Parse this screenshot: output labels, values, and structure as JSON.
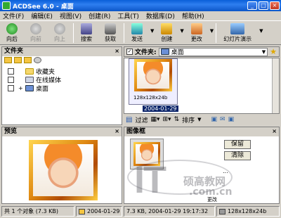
{
  "window": {
    "title": "ACDSee 6.0 - 桌面",
    "minimize": "_",
    "maximize": "□",
    "close": "×"
  },
  "menu": [
    "文件(F)",
    "编辑(E)",
    "视图(V)",
    "创建(R)",
    "工具(T)",
    "数据库(D)",
    "帮助(H)"
  ],
  "toolbar": {
    "back": "向后",
    "forward": "向前",
    "up": "向上",
    "search": "搜索",
    "acquire": "获取",
    "send": "发送",
    "create": "创建",
    "modify": "更改",
    "slideshow": "幻灯片演示"
  },
  "folders_panel": {
    "title": "文件夹",
    "items": [
      {
        "label": "收藏夹",
        "checked": false,
        "expander": ""
      },
      {
        "label": "在线媒体",
        "checked": false,
        "expander": ""
      },
      {
        "label": "桌面",
        "checked": false,
        "expander": "+"
      }
    ]
  },
  "address": {
    "label": "文件夹:",
    "value": "桌面",
    "checked": "✓"
  },
  "file_list": {
    "thumb_caption": "128x128x24b",
    "thumb_date": "2004-01-29"
  },
  "filter_bar": {
    "filter": "过滤",
    "sort": "排序"
  },
  "preview_panel": {
    "title": "预览"
  },
  "image_basket": {
    "title": "图像框",
    "keep": "保留",
    "clear": "清除",
    "more": "...",
    "manage": "更改"
  },
  "watermark": {
    "big": "IT",
    "site": ".com.cn",
    "cn": "硕高教网"
  },
  "status_bar": {
    "total": "共 1 个对象",
    "total_size": "(7.3 KB)",
    "date": "2004-01-29",
    "detail": "7.3 KB, 2004-01-29 19:17:32",
    "dims": "128x128x24b"
  }
}
